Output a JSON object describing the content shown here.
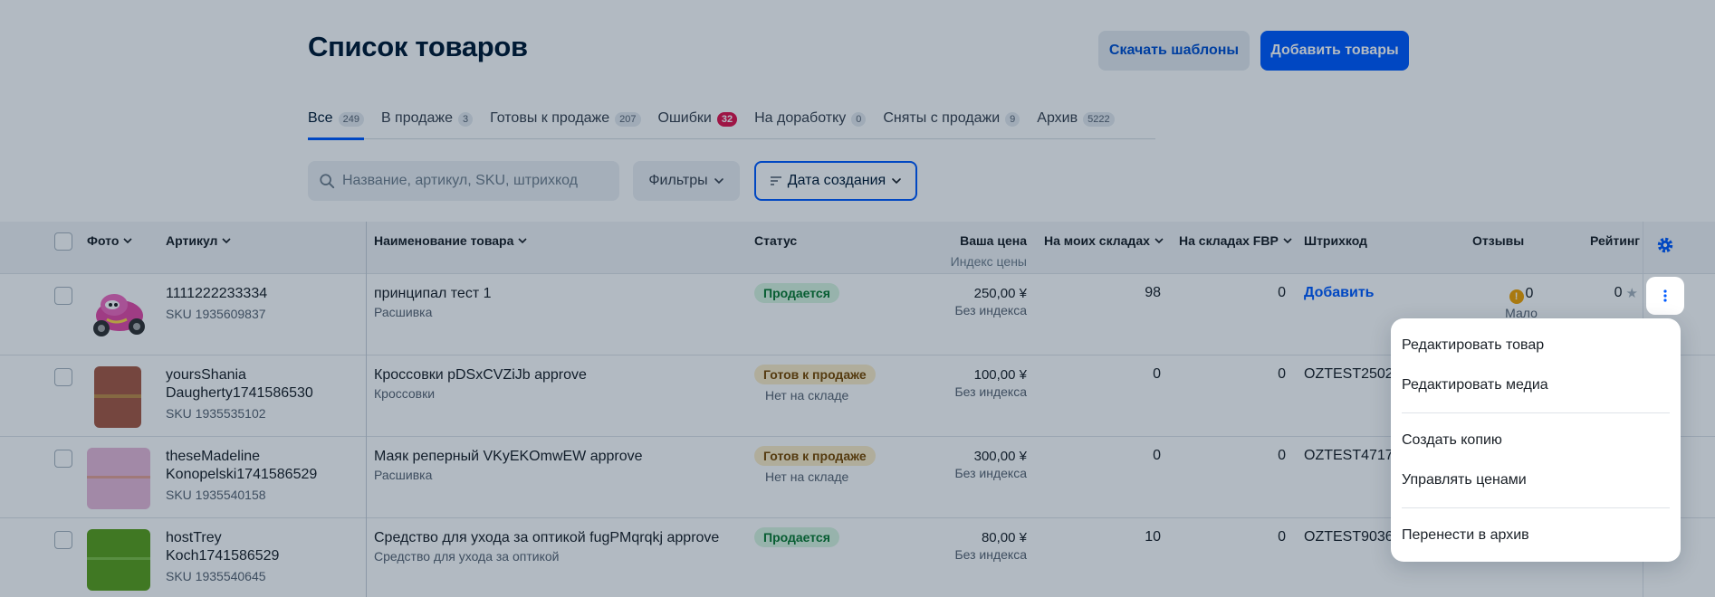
{
  "page": {
    "title": "Список товаров",
    "download_button": "Скачать шаблоны",
    "add_button": "Добавить товары"
  },
  "tabs": [
    {
      "label": "Все",
      "count": "249",
      "active": true
    },
    {
      "label": "В продаже",
      "count": "3"
    },
    {
      "label": "Готовы к продаже",
      "count": "207"
    },
    {
      "label": "Ошибки",
      "count": "32",
      "alert": true
    },
    {
      "label": "На доработку",
      "count": "0"
    },
    {
      "label": "Сняты с продажи",
      "count": "9"
    },
    {
      "label": "Архив",
      "count": "5222"
    }
  ],
  "toolbar": {
    "search_placeholder": "Название, артикул, SKU, штрихкод",
    "filters_label": "Фильтры",
    "sort_label": "Дата создания"
  },
  "table": {
    "headers": {
      "photo": "Фото",
      "article": "Артикул",
      "name": "Наименование товара",
      "status": "Статус",
      "price": "Ваша цена",
      "price_sub": "Индекс цены",
      "my_stock": "На моих складах",
      "fbp_stock": "На складах FBP",
      "barcode": "Штрихкод",
      "reviews": "Отзывы",
      "rating": "Рейтинг"
    },
    "rows": [
      {
        "article": "1111222233334",
        "sku": "SKU 1935609837",
        "name": "принципал тест 1",
        "category": "Расшивка",
        "status": "Продается",
        "status_type": "green",
        "status_note": "",
        "price": "250,00 ¥",
        "price_index": "Без индекса",
        "my_stock": "98",
        "fbp_stock": "0",
        "barcode": "Добавить",
        "barcode_link": true,
        "reviews": "0",
        "reviews_note": "Мало",
        "rating": "0",
        "thumb_color": "#ffffff"
      },
      {
        "article": "yoursShania Daugherty1741586530",
        "sku": "SKU 1935535102",
        "name": "Кроссовки pDSxCVZiJb approve",
        "category": "Кроссовки",
        "status": "Готов к продаже",
        "status_type": "amber",
        "status_note": "Нет на складе",
        "price": "100,00 ¥",
        "price_index": "Без индекса",
        "my_stock": "0",
        "fbp_stock": "0",
        "barcode": "OZTEST2502",
        "thumb_color": "#a85a44"
      },
      {
        "article": "theseMadeline Konopelski1741586529",
        "sku": "SKU 1935540158",
        "name": "Маяк реперный VKyEKOmwEW approve",
        "category": "Расшивка",
        "status": "Готов к продаже",
        "status_type": "amber",
        "status_note": "Нет на складе",
        "price": "300,00 ¥",
        "price_index": "Без индекса",
        "my_stock": "0",
        "fbp_stock": "0",
        "barcode": "OZTEST4717",
        "thumb_color": "#e8b9d8"
      },
      {
        "article": "hostTrey Koch1741586529",
        "sku": "SKU 1935540645",
        "name": "Средство для ухода за оптикой fugPMqrqkj approve",
        "category": "Средство для ухода за оптикой",
        "status": "Продается",
        "status_type": "green",
        "status_note": "",
        "price": "80,00 ¥",
        "price_index": "Без индекса",
        "my_stock": "10",
        "fbp_stock": "0",
        "barcode": "OZTEST9036",
        "thumb_color": "#5ca11c"
      }
    ]
  },
  "context_menu": {
    "items": [
      "Редактировать товар",
      "Редактировать медиа",
      "Создать копию",
      "Управлять ценами",
      "Перенести в архив"
    ]
  },
  "colors": {
    "primary": "#005bff",
    "overlay": "#001a34"
  }
}
